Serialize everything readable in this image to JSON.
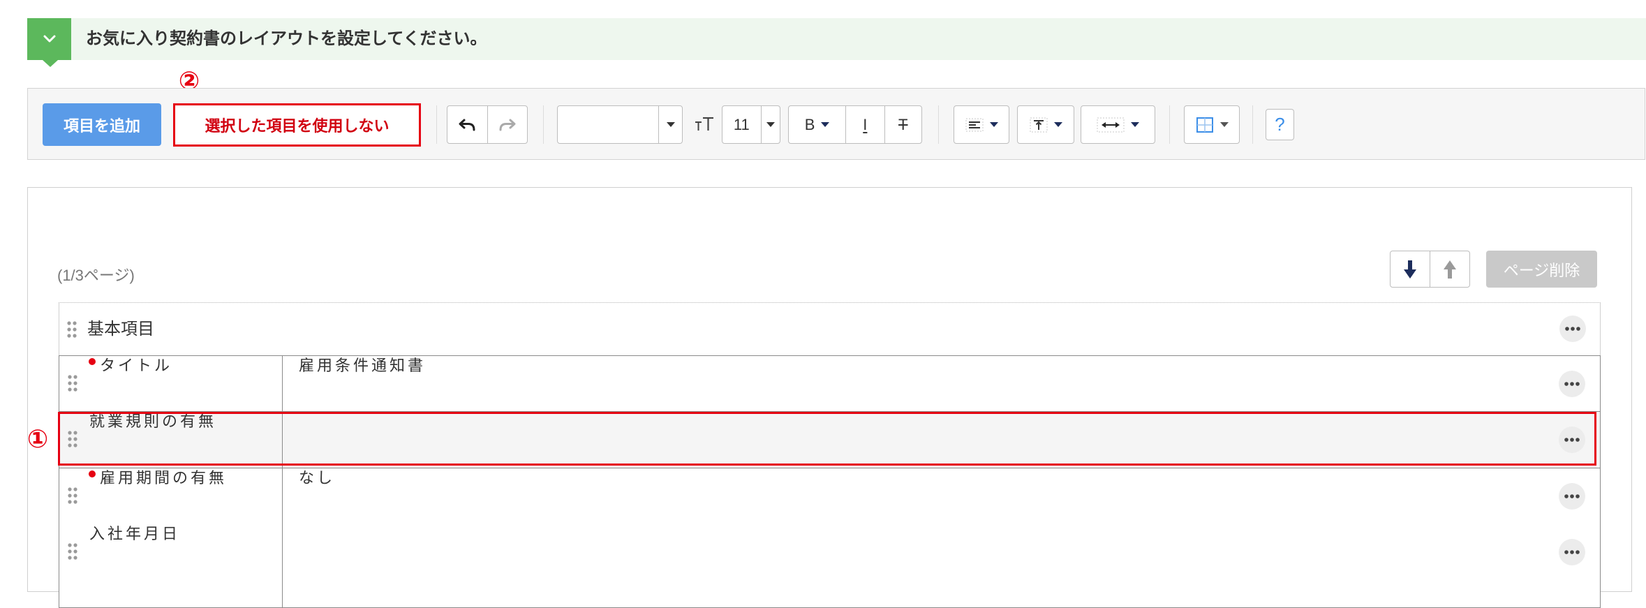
{
  "banner": {
    "text": "お気に入り契約書のレイアウトを設定してください。",
    "toggle_icon": "chevron-down-icon"
  },
  "annotations": {
    "marker_1": "①",
    "marker_2": "②"
  },
  "toolbar": {
    "add_item_label": "項目を追加",
    "disable_selected_label": "選択した項目を使用しない",
    "undo_icon": "undo-icon",
    "redo_icon": "redo-icon",
    "font_family_icon": "dropdown-caret-icon",
    "font_size_icon": "font-size-icon",
    "font_size_value": "11",
    "bold_label": "B",
    "italic_label": "I",
    "strikethrough_label": "T",
    "align_icon": "align-left-icon",
    "vertical_align_icon": "vertical-align-top-icon",
    "width_icon": "width-arrows-icon",
    "border_icon": "border-grid-icon",
    "help_label": "?"
  },
  "page": {
    "indicator": "(1/3ページ)",
    "move_down_icon": "arrow-down-icon",
    "move_up_icon": "arrow-up-icon",
    "delete_label": "ページ削除"
  },
  "section": {
    "title": "基本項目",
    "drag_icon": "drag-handle-icon",
    "more_icon": "ellipsis-icon"
  },
  "rows": [
    {
      "label": "タイトル",
      "required": true,
      "value": "雇用条件通知書",
      "selected": false
    },
    {
      "label": "就業規則の有無",
      "required": false,
      "value": "",
      "selected": true
    },
    {
      "label": "雇用期間の有無",
      "required": true,
      "value": "なし",
      "selected": false
    },
    {
      "label": "入社年月日",
      "required": false,
      "value": "",
      "selected": false
    }
  ],
  "colors": {
    "annotation_red": "#e60012",
    "primary_blue": "#5a9be8",
    "banner_green": "#5cb85c",
    "banner_background": "#eef7ee",
    "disabled_gray": "#c9c9c9"
  }
}
